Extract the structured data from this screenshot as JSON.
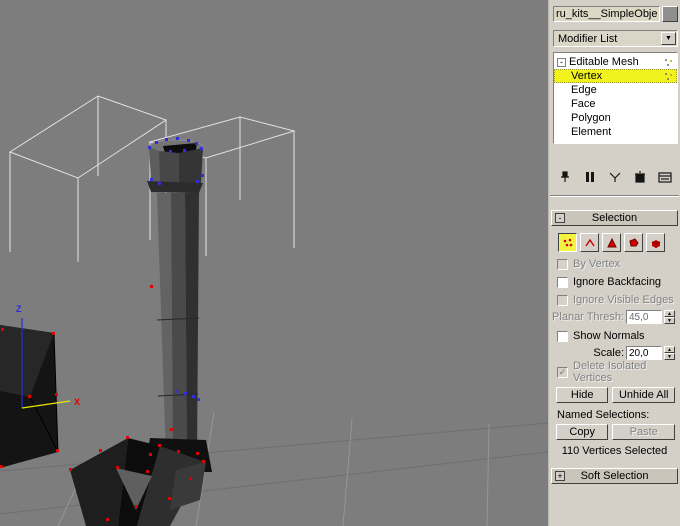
{
  "icons": {
    "collapse": "-",
    "expand": "+",
    "dropdown_arrow": "▼",
    "check": "✓",
    "spin_up": "▲",
    "spin_down": "▼"
  },
  "colors": {
    "viewport_bg": "#7d7d7d",
    "panel_bg": "#d4d0c8",
    "stack_selection_highlight": "#f2f21e",
    "vertex_red": "#e10000",
    "vertex_selected_blue": "#2f2fe0",
    "axis_x": "#e10000",
    "axis_z": "#2a2ae0",
    "wireframe": "#e2e2e2"
  },
  "viewport": {
    "axis_labels": {
      "x": "X",
      "z": "Z"
    }
  },
  "panel": {
    "object_name": "ru_kits__SimpleObject",
    "modifier_dropdown_label": "Modifier List",
    "stack": {
      "root": "Editable Mesh",
      "selected": "Vertex",
      "children": [
        "Vertex",
        "Edge",
        "Face",
        "Polygon",
        "Element"
      ]
    },
    "selection": {
      "title": "Selection",
      "subobject_modes": [
        "Vertex",
        "Edge",
        "Face",
        "Polygon",
        "Element"
      ],
      "active_mode": "Vertex",
      "checkboxes": [
        {
          "label": "By Vertex",
          "checked": false,
          "disabled": true
        },
        {
          "label": "Ignore Backfacing",
          "checked": false,
          "disabled": false
        },
        {
          "label": "Ignore Visible Edges",
          "checked": false,
          "disabled": true
        },
        {
          "label": "Show Normals",
          "checked": false,
          "disabled": false
        },
        {
          "label": "Delete Isolated Vertices",
          "checked": true,
          "disabled": true
        }
      ],
      "spinners": [
        {
          "label": "Planar Thresh:",
          "value": "45,0",
          "disabled": true
        },
        {
          "label": "Scale:",
          "value": "20,0",
          "disabled": false
        }
      ],
      "buttons": {
        "hide": "Hide",
        "unhide_all": "Unhide All",
        "copy": "Copy",
        "paste": "Paste"
      },
      "named_selections_label": "Named Selections:",
      "status": "110 Vertices Selected"
    },
    "soft_selection": {
      "title": "Soft Selection"
    }
  }
}
